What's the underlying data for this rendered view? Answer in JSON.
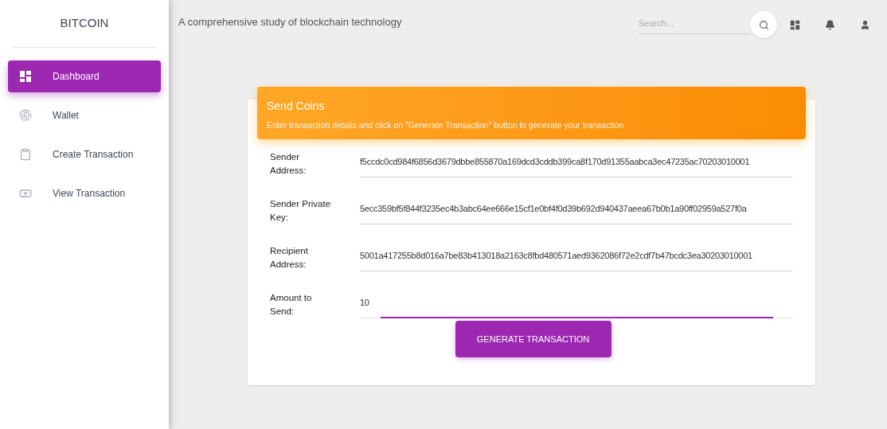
{
  "sidebar": {
    "brand": "BITCOIN",
    "items": [
      {
        "label": "Dashboard",
        "selected": true
      },
      {
        "label": "Wallet",
        "selected": false
      },
      {
        "label": "Create Transaction",
        "selected": false
      },
      {
        "label": "View Transaction",
        "selected": false
      }
    ]
  },
  "header": {
    "title": "A comprehensive study of blockchain technology",
    "search": {
      "placeholder": "Search..."
    }
  },
  "card": {
    "title": "Send Coins",
    "subtitle": "Enter transaction details and click on \"Generate Transaction\" button to generate your transaction",
    "fields": [
      {
        "label": "Sender Address:",
        "value": "f5ccdc0cd984f6856d3679dbbe855870a169dcd3cddb399ca8f170d91355aabca3ec47235ac70203010001",
        "focused": false
      },
      {
        "label": "Sender Private Key:",
        "value": "5ecc359bf5f844f3235ec4b3abc64ee666e15cf1e0bf4f0d39b692d940437aeea67b0b1a90ff02959a527f0a",
        "focused": false
      },
      {
        "label": "Recipient Address:",
        "value": "5001a417255b8d016a7be83b413018a2163c8fbd480571aed9362086f72e2cdf7b47bcdc3ea30203010001",
        "focused": false
      },
      {
        "label": "Amount to Send:",
        "value": "10",
        "focused": true
      }
    ],
    "button": "GENERATE TRANSACTION"
  }
}
